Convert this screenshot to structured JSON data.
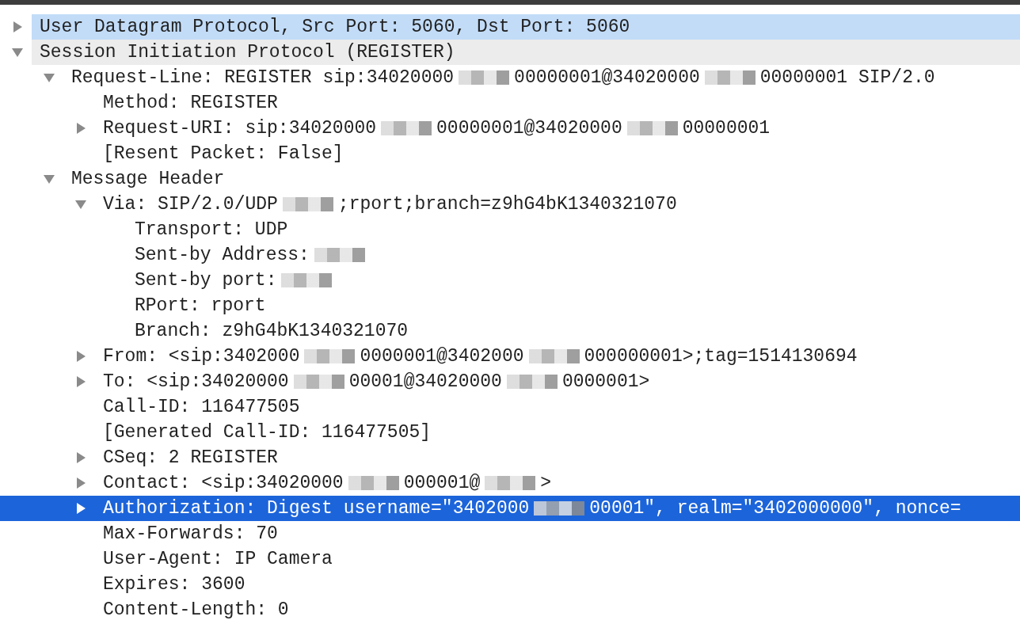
{
  "tree": [
    {
      "label": "User Datagram Protocol, Src Port: 5060, Dst Port: 5060",
      "expanded": false,
      "selected": false,
      "kind": "related"
    },
    {
      "label": "Session Initiation Protocol (REGISTER)",
      "expanded": true,
      "selected": false,
      "kind": "header",
      "children": [
        {
          "segments": [
            {
              "kind": "text",
              "text": "Request-Line: REGISTER sip:34020000"
            },
            {
              "kind": "redacted"
            },
            {
              "kind": "text",
              "text": "00000001@34020000"
            },
            {
              "kind": "redacted"
            },
            {
              "kind": "text",
              "text": "00000001 SIP/2.0"
            }
          ],
          "expanded": true,
          "selected": false,
          "children": [
            {
              "label": "Method: REGISTER",
              "selected": false
            },
            {
              "segments": [
                {
                  "kind": "text",
                  "text": "Request-URI: sip:34020000"
                },
                {
                  "kind": "redacted"
                },
                {
                  "kind": "text",
                  "text": "00000001@34020000"
                },
                {
                  "kind": "redacted"
                },
                {
                  "kind": "text",
                  "text": "00000001"
                }
              ],
              "expanded": false,
              "selected": false
            },
            {
              "label": "[Resent Packet: False]",
              "selected": false
            }
          ]
        },
        {
          "label": "Message Header",
          "expanded": true,
          "selected": false,
          "children": [
            {
              "segments": [
                {
                  "kind": "text",
                  "text": "Via: SIP/2.0/UDP"
                },
                {
                  "kind": "redacted"
                },
                {
                  "kind": "text",
                  "text": ";rport;branch=z9hG4bK1340321070"
                }
              ],
              "expanded": true,
              "selected": false,
              "children": [
                {
                  "label": "Transport: UDP",
                  "selected": false
                },
                {
                  "segments": [
                    {
                      "kind": "text",
                      "text": "Sent-by Address:"
                    },
                    {
                      "kind": "redacted"
                    }
                  ],
                  "selected": false
                },
                {
                  "segments": [
                    {
                      "kind": "text",
                      "text": "Sent-by port:"
                    },
                    {
                      "kind": "redacted"
                    }
                  ],
                  "selected": false
                },
                {
                  "label": "RPort: rport",
                  "selected": false
                },
                {
                  "label": "Branch: z9hG4bK1340321070",
                  "selected": false
                }
              ]
            },
            {
              "segments": [
                {
                  "kind": "text",
                  "text": "From: <sip:3402000"
                },
                {
                  "kind": "redacted"
                },
                {
                  "kind": "text",
                  "text": "0000001@3402000"
                },
                {
                  "kind": "redacted"
                },
                {
                  "kind": "text",
                  "text": "000000001>;tag=1514130694"
                }
              ],
              "expanded": false,
              "selected": false
            },
            {
              "segments": [
                {
                  "kind": "text",
                  "text": "To: <sip:34020000"
                },
                {
                  "kind": "redacted"
                },
                {
                  "kind": "text",
                  "text": "00001@34020000"
                },
                {
                  "kind": "redacted"
                },
                {
                  "kind": "text",
                  "text": "0000001>"
                }
              ],
              "expanded": false,
              "selected": false
            },
            {
              "label": "Call-ID: 116477505",
              "selected": false
            },
            {
              "label": "[Generated Call-ID: 116477505]",
              "selected": false
            },
            {
              "label": "CSeq: 2 REGISTER",
              "expanded": false,
              "selected": false
            },
            {
              "segments": [
                {
                  "kind": "text",
                  "text": "Contact: <sip:34020000"
                },
                {
                  "kind": "redacted"
                },
                {
                  "kind": "text",
                  "text": "000001@"
                },
                {
                  "kind": "redacted"
                },
                {
                  "kind": "text",
                  "text": ">"
                }
              ],
              "expanded": false,
              "selected": false
            },
            {
              "segments": [
                {
                  "kind": "text",
                  "text": "Authorization: Digest username=\"3402000"
                },
                {
                  "kind": "redacted"
                },
                {
                  "kind": "text",
                  "text": "00001\", realm=\"3402000000\", nonce="
                }
              ],
              "expanded": false,
              "selected": true
            },
            {
              "label": "Max-Forwards: 70",
              "selected": false
            },
            {
              "label": "User-Agent: IP Camera",
              "selected": false
            },
            {
              "label": "Expires: 3600",
              "selected": false
            },
            {
              "label": "Content-Length: 0",
              "selected": false
            }
          ]
        }
      ]
    }
  ]
}
